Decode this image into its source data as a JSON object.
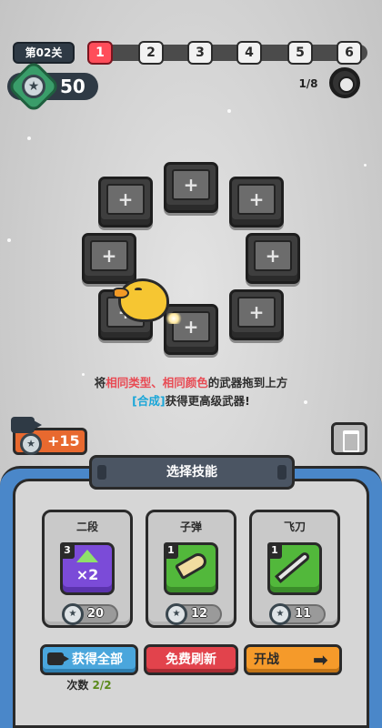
{
  "top_bar": {
    "level_label": "第02关",
    "stages": [
      "1",
      "2",
      "3",
      "4",
      "5",
      "6"
    ],
    "active_stage": 1,
    "gems": "50",
    "wave": "1/8"
  },
  "hint": {
    "line1_a": "将",
    "line1_b": "相同类型",
    "line1_c": "、",
    "line1_d": "相同颜色",
    "line1_e": "的武器拖到上方",
    "line2_a": "[合成]",
    "line2_b": "获得更高级武器!"
  },
  "video_bonus": {
    "value": "+15"
  },
  "panel": {
    "title": "选择技能",
    "skills": [
      {
        "name": "二段",
        "level": "3",
        "glyph": "×2",
        "cost": "20",
        "color": "purple"
      },
      {
        "name": "子弹",
        "level": "1",
        "glyph": "",
        "cost": "12",
        "color": "green"
      },
      {
        "name": "飞刀",
        "level": "1",
        "glyph": "",
        "cost": "11",
        "color": "green"
      }
    ],
    "buttons": {
      "get_all": "获得全部",
      "free_refresh": "免费刷新",
      "start": "开战"
    },
    "count_prefix": "次数",
    "count_value": "2/2"
  },
  "icons": {
    "gem": "star-gem-icon",
    "settings": "gear-icon",
    "video": "video-camera-icon",
    "trash": "recycle-bin-icon",
    "coin": "star-coin-icon",
    "arrow": "arrow-right-icon"
  },
  "colors": {
    "active_stage": "#ff4d5a",
    "panel_blue": "#4a87c9",
    "get_all": "#4aa6dc",
    "refresh": "#e2434c",
    "start": "#f59a2a",
    "hint_red": "#e84a53",
    "hint_cyan": "#1aa6d8"
  }
}
